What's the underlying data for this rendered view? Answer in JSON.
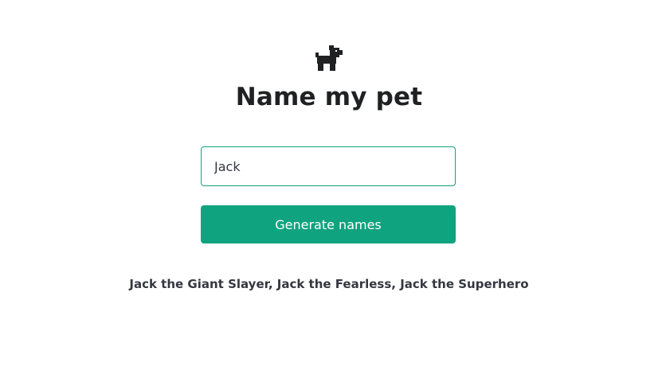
{
  "header": {
    "logo_icon": "dog-icon",
    "title": "Name my pet"
  },
  "form": {
    "input_value": "Jack",
    "button_label": "Generate names"
  },
  "result": {
    "text": "Jack the Giant Slayer, Jack the Fearless, Jack the Superhero"
  },
  "colors": {
    "accent": "#10a37f",
    "title": "#202123",
    "text": "#353740",
    "background": "#ffffff"
  }
}
